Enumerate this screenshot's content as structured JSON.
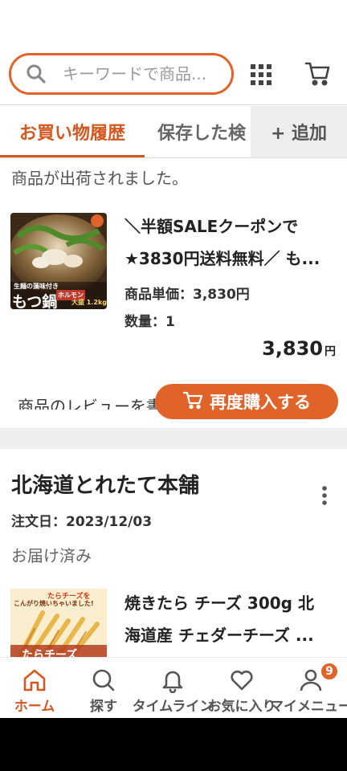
{
  "search": {
    "placeholder": "キーワードで商品..."
  },
  "tabs": {
    "active": "お買い物履歴",
    "second": "保存した検",
    "add": "+ 追加"
  },
  "order1": {
    "status_message": "商品が出荷されました。",
    "title_line1": "＼半額SALEクーポンで",
    "title_line2": "★3830円送料無料／ も...",
    "unit_price": "商品単価：3,830円",
    "quantity": "数量：1",
    "price": "3,830",
    "price_unit": "円",
    "review_text": "商品のレビューを書",
    "rebuy_label": "再度購入する",
    "image_text": {
      "main": "もつ鍋",
      "sub1": "ホルモン",
      "sub2": "大盛 1.2kg",
      "top": "生麺の藻味付き"
    }
  },
  "order2": {
    "shop_name": "北海道とれたて本舗",
    "order_date": "注文日：2023/12/03",
    "status": "お届け済み",
    "title_line1": "焼きたら チーズ 300g 北",
    "title_line2": "海道産 チェダーチーズ ...",
    "image_text": {
      "top1": "たらチーズを",
      "top2": "こんがり焼いちゃいました!",
      "bottom": "たらチーズ"
    }
  },
  "nav": {
    "items": [
      {
        "label": "ホーム",
        "icon": "home-icon"
      },
      {
        "label": "探す",
        "icon": "search-icon"
      },
      {
        "label": "タイムライン",
        "icon": "bell-icon"
      },
      {
        "label": "お気に入り",
        "icon": "heart-icon"
      },
      {
        "label": "マイメニュー",
        "icon": "user-icon"
      }
    ],
    "badge_count": "9"
  },
  "colors": {
    "accent": "#e0632a",
    "accent_text": "#d4571f"
  }
}
